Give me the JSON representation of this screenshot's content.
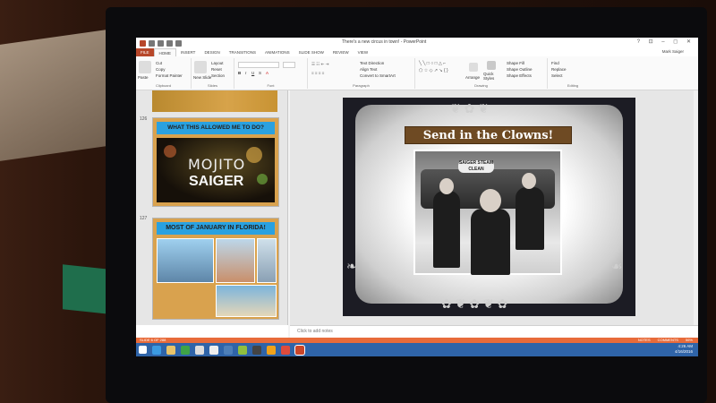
{
  "window": {
    "title": "There's a new circus in town! - PowerPoint",
    "user": "Mark Saiger",
    "controls": "? ⊡ – ◻ ✕"
  },
  "tabs": [
    "FILE",
    "HOME",
    "INSERT",
    "DESIGN",
    "TRANSITIONS",
    "ANIMATIONS",
    "SLIDE SHOW",
    "REVIEW",
    "VIEW"
  ],
  "ribbon": {
    "clipboard": {
      "paste": "Paste",
      "cut": "Cut",
      "copy": "Copy",
      "format_painter": "Format Painter",
      "label": "Clipboard"
    },
    "slides": {
      "new_slide": "New Slide",
      "layout": "Layout",
      "reset": "Reset",
      "section": "Section",
      "label": "Slides"
    },
    "font": {
      "label": "Font"
    },
    "paragraph": {
      "text_direction": "Text Direction",
      "align_text": "Align Text",
      "convert": "Convert to SmartArt",
      "label": "Paragraph"
    },
    "drawing": {
      "arrange": "Arrange",
      "quick_styles": "Quick Styles",
      "shape_fill": "Shape Fill",
      "shape_outline": "Shape Outline",
      "shape_effects": "Shape Effects",
      "label": "Drawing"
    },
    "editing": {
      "find": "Find",
      "replace": "Replace",
      "select": "Select",
      "label": "Editing"
    }
  },
  "thumbnails": [
    {
      "number": "126",
      "banner": "WHAT THIS ALLOWED ME TO DO?",
      "art_line1": "MOJITO",
      "art_line2": "SAIGER"
    },
    {
      "number": "127",
      "banner": "MOST OF JANUARY IN FLORIDA!"
    }
  ],
  "slide": {
    "title": "Send in the Clowns!",
    "photo_sign": "SAIGER STEAM CLEAN"
  },
  "notes_placeholder": "Click to add notes",
  "status": {
    "slide_counter": "SLIDE 6 OF 288",
    "notes_btn": "NOTES",
    "comments_btn": "COMMENTS",
    "zoom": "56%"
  },
  "clock": {
    "time": "4:26 AM",
    "date": "4/16/2016"
  },
  "colors": {
    "accent": "#b7472a",
    "taskbar": "#2f64a8",
    "statusbar": "#e86b3a",
    "banner": "#2aa1e0",
    "title_box": "#6e4a23"
  }
}
